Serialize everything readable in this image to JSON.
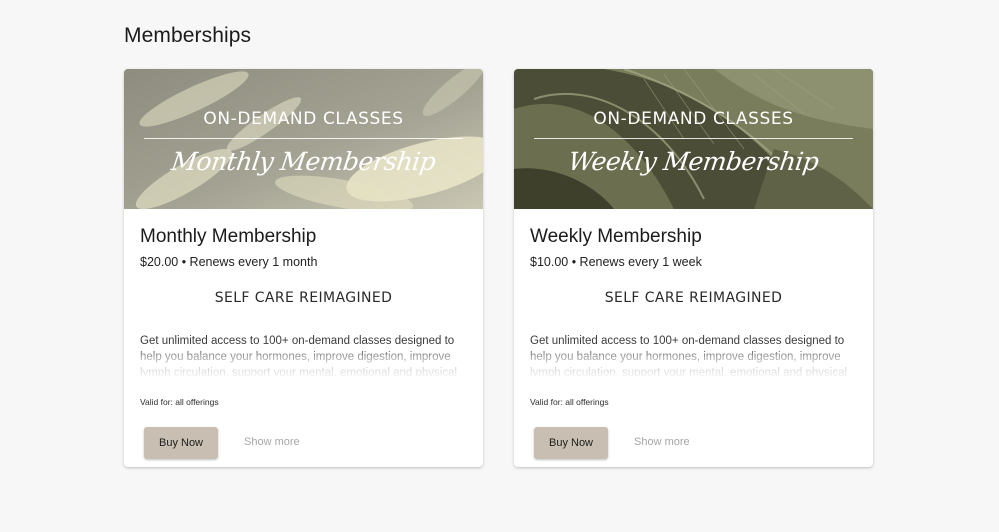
{
  "page": {
    "title": "Memberships"
  },
  "memberships": [
    {
      "banner_heading": "ON-DEMAND CLASSES",
      "banner_script": "Monthly Membership",
      "name": "Monthly Membership",
      "price_line": "$20.00 • Renews every 1 month",
      "tagline": "SELF CARE REIMAGINED",
      "description": "Get unlimited access to 100+ on-demand classes designed to help you balance your hormones, improve digestion, improve lymph circulation, support your mental, emotional and physical health",
      "valid_for": "Valid for: all offerings",
      "buy_label": "Buy Now",
      "more_label": "Show more"
    },
    {
      "banner_heading": "ON-DEMAND CLASSES",
      "banner_script": "Weekly Membership",
      "name": "Weekly Membership",
      "price_line": "$10.00 • Renews every 1 week",
      "tagline": "SELF CARE REIMAGINED",
      "description": "Get unlimited access to 100+ on-demand classes designed to help you balance your hormones, improve digestion, improve lymph circulation, support your mental, emotional and physical health",
      "valid_for": "Valid for: all offerings",
      "buy_label": "Buy Now",
      "more_label": "Show more"
    }
  ],
  "colors": {
    "page_bg": "#f7f7f7",
    "button_bg": "#c8bfb2",
    "link": "#a6a6a6"
  }
}
